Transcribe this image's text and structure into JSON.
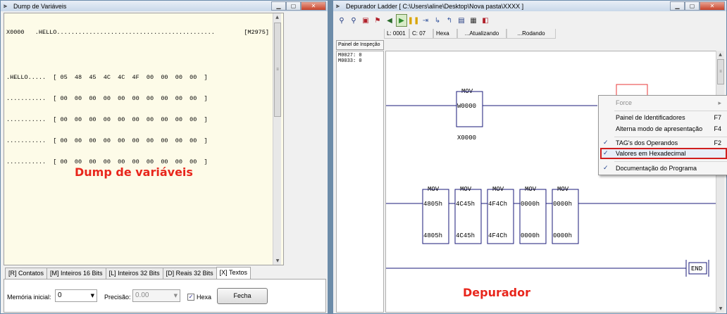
{
  "dump": {
    "title": "Dump de Variáveis",
    "header_left": "X0000   .HELLO............................................",
    "header_right": "[M2975]",
    "rows": [
      ".HELLO.....  [ 05  48  45  4C  4C  4F  00  00  00  00  ]",
      "...........  [ 00  00  00  00  00  00  00  00  00  00  ]",
      "...........  [ 00  00  00  00  00  00  00  00  00  00  ]",
      "...........  [ 00  00  00  00  00  00  00  00  00  00  ]",
      "...........  [ 00  00  00  00  00  00  00  00  00  00  ]"
    ],
    "overlay_label": "Dump de variáveis",
    "tabs": [
      "[R] Contatos",
      "[M] Inteiros 16 Bits",
      "[L] Inteiros 32 Bits",
      "[D] Reais 32 Bits",
      "[X] Textos"
    ],
    "active_tab": "[X] Textos",
    "memoria_label": "Memória inicial:",
    "memoria_value": "0",
    "precisao_label": "Precisão:",
    "precisao_value": "0.00",
    "hexa_label": "Hexa",
    "hexa_checked": true,
    "fecha_label": "Fecha"
  },
  "ladder": {
    "title": "Depurador Ladder [ C:\\Users\\aline\\Desktop\\Nova pasta\\XXXX ]",
    "toolbar_icons": [
      "binoculars-icon",
      "find-next-icon",
      "debug-icon",
      "force-icon",
      "back-icon",
      "play-icon",
      "pause-icon",
      "step-icon",
      "step-into-icon",
      "step-out-icon",
      "save-icon",
      "grid-icon",
      "breakpoint-icon"
    ],
    "status": {
      "line": "L: 0001",
      "col": "C: 07",
      "mode": "Hexa",
      "updating": "...Atualizando",
      "running": "...Rodando"
    },
    "inspection_label": "Painel de Inspeção",
    "inspection_lines": [
      "M0027: 0",
      "M0033: 0"
    ],
    "overlay_label": "Depurador",
    "rung1": {
      "block": "MOV",
      "in": "W0000",
      "out": "X0000"
    },
    "rung2": [
      {
        "block": "MOV",
        "in": "4805h",
        "out": "4805h"
      },
      {
        "block": "MOV",
        "in": "4C45h",
        "out": "4C45h"
      },
      {
        "block": "MOV",
        "in": "4F4Ch",
        "out": "4F4Ch"
      },
      {
        "block": "MOV",
        "in": "0000h",
        "out": "0000h"
      },
      {
        "block": "MOV",
        "in": "0000h",
        "out": "0000h"
      }
    ],
    "end_label": "END",
    "context_menu": {
      "force": "Force",
      "painel": "Painel de Identificadores",
      "painel_sc": "F7",
      "alterna": "Alterna modo de apresentação",
      "alterna_sc": "F4",
      "tags": "TAG's dos Operandos",
      "tags_sc": "F2",
      "hexa": "Valores em Hexadecimal",
      "doc": "Documentação do Programa"
    }
  },
  "colors": {
    "annotation_red": "#e8261c",
    "highlight_box": "#d01f1f",
    "ladder_rail": "#1a1a7a"
  }
}
